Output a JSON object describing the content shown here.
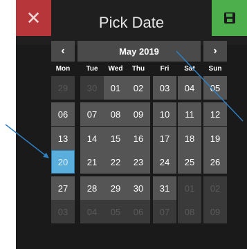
{
  "header": {
    "title": "Pick Date",
    "close_icon": "close-icon",
    "save_icon": "save-icon"
  },
  "nav": {
    "prev": "‹",
    "month": "May 2019",
    "next": "›"
  },
  "weekdays": [
    "Mon",
    "Tue",
    "Wed",
    "Thu",
    "Fri",
    "Sat",
    "Sun"
  ],
  "days": [
    {
      "label": "29",
      "state": "other"
    },
    {
      "label": "30",
      "state": "other"
    },
    {
      "label": "01",
      "state": "cur"
    },
    {
      "label": "02",
      "state": "cur"
    },
    {
      "label": "03",
      "state": "cur"
    },
    {
      "label": "04",
      "state": "cur"
    },
    {
      "label": "05",
      "state": "cur"
    },
    {
      "label": "06",
      "state": "cur"
    },
    {
      "label": "07",
      "state": "cur"
    },
    {
      "label": "08",
      "state": "cur"
    },
    {
      "label": "09",
      "state": "cur"
    },
    {
      "label": "10",
      "state": "cur"
    },
    {
      "label": "11",
      "state": "cur"
    },
    {
      "label": "12",
      "state": "cur"
    },
    {
      "label": "13",
      "state": "cur"
    },
    {
      "label": "14",
      "state": "cur"
    },
    {
      "label": "15",
      "state": "cur"
    },
    {
      "label": "16",
      "state": "cur"
    },
    {
      "label": "17",
      "state": "cur"
    },
    {
      "label": "18",
      "state": "cur"
    },
    {
      "label": "19",
      "state": "cur"
    },
    {
      "label": "20",
      "state": "sel"
    },
    {
      "label": "21",
      "state": "cur"
    },
    {
      "label": "22",
      "state": "cur"
    },
    {
      "label": "23",
      "state": "cur"
    },
    {
      "label": "24",
      "state": "cur"
    },
    {
      "label": "25",
      "state": "cur"
    },
    {
      "label": "26",
      "state": "cur"
    },
    {
      "label": "27",
      "state": "cur"
    },
    {
      "label": "28",
      "state": "cur"
    },
    {
      "label": "29",
      "state": "cur"
    },
    {
      "label": "30",
      "state": "cur"
    },
    {
      "label": "31",
      "state": "cur"
    },
    {
      "label": "01",
      "state": "other"
    },
    {
      "label": "02",
      "state": "other"
    },
    {
      "label": "03",
      "state": "other"
    },
    {
      "label": "04",
      "state": "other"
    },
    {
      "label": "05",
      "state": "other"
    },
    {
      "label": "06",
      "state": "other"
    },
    {
      "label": "07",
      "state": "other"
    },
    {
      "label": "08",
      "state": "other"
    },
    {
      "label": "09",
      "state": "other"
    }
  ],
  "colors": {
    "close": "#b6363a",
    "save": "#4caf4c",
    "selected": "#5aaedc",
    "annotation": "#2f7fc1"
  }
}
